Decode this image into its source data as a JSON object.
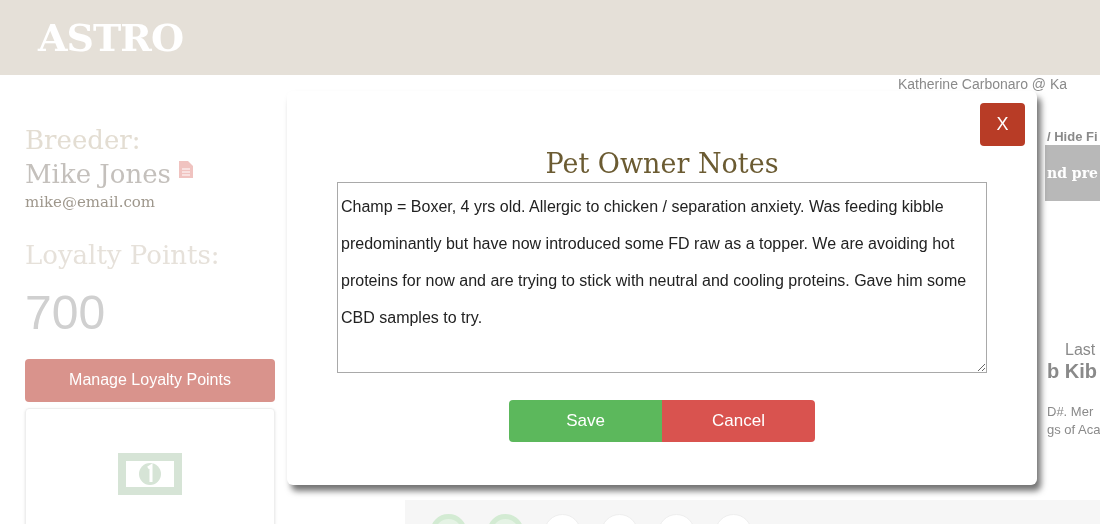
{
  "header": {
    "logo": "ASTRO"
  },
  "background": {
    "user": "Katherine Carbonaro @ Ka",
    "toggle_link": "/ Hide Fi",
    "banner": "nd pre",
    "last_label": "Last",
    "product": "b Kib",
    "detail_lines": [
      "D#. Mer",
      "gs of Aca"
    ],
    "breeder_label": "Breeder:",
    "breeder_name": "Mike Jones",
    "breeder_email": "mike@email.com",
    "points_label": "Loyalty Points:",
    "points": "700",
    "manage_button": "Manage Loyalty Points",
    "progress_steps": [
      {
        "done": true
      },
      {
        "done": true
      },
      {
        "done": false
      },
      {
        "done": false
      },
      {
        "done": false
      },
      {
        "done": false
      }
    ]
  },
  "modal": {
    "title": "Pet Owner Notes",
    "close": "X",
    "notes": "Champ = Boxer, 4 yrs old. Allergic to chicken / separation anxiety. Was feeding kibble predominantly but have now introduced some FD raw as a topper. We are avoiding hot proteins for now and are trying to stick with neutral and cooling proteins. Gave him some CBD samples to try.",
    "buttons": [
      {
        "kind": "save",
        "label": "Save"
      },
      {
        "kind": "cancel",
        "label": "Cancel"
      }
    ]
  }
}
